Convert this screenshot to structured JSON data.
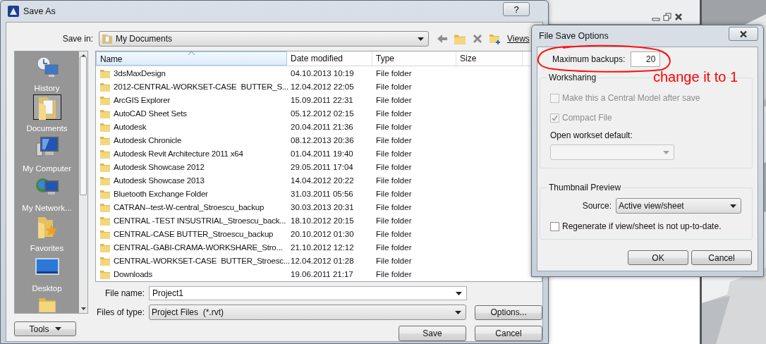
{
  "save_as": {
    "title": "Save As",
    "help": "?",
    "save_in": {
      "label": "Save in:",
      "value": "My Documents"
    },
    "views": "Views",
    "places": [
      {
        "label": "History",
        "kind": "history",
        "selected": false
      },
      {
        "label": "Documents",
        "kind": "documents",
        "selected": true
      },
      {
        "label": "My Computer",
        "kind": "computer",
        "selected": false
      },
      {
        "label": "My Network...",
        "kind": "network",
        "selected": false
      },
      {
        "label": "Favorites",
        "kind": "favorites",
        "selected": false
      },
      {
        "label": "Desktop",
        "kind": "desktop",
        "selected": false
      }
    ],
    "columns": [
      {
        "label": "Name",
        "sorted": true
      },
      {
        "label": "Date modified",
        "sorted": false
      },
      {
        "label": "Type",
        "sorted": false
      },
      {
        "label": "Size",
        "sorted": false
      }
    ],
    "rows": [
      {
        "name": "3dsMaxDesign",
        "date": "04.10.2013 10:19",
        "type": "File folder"
      },
      {
        "name": "2012-CENTRAL-WORKSET-CASE  BUTTER_S...",
        "date": "12.04.2012 22:05",
        "type": "File folder"
      },
      {
        "name": "ArcGIS Explorer",
        "date": "15.09.2011 22:31",
        "type": "File folder"
      },
      {
        "name": "AutoCAD Sheet Sets",
        "date": "05.12.2012 02:15",
        "type": "File folder"
      },
      {
        "name": "Autodesk",
        "date": "20.04.2011 21:36",
        "type": "File folder"
      },
      {
        "name": "Autodesk Chronicle",
        "date": "08.12.2013 20:36",
        "type": "File folder"
      },
      {
        "name": "Autodesk Revit Architecture 2011 x64",
        "date": "01.04.2011 19:40",
        "type": "File folder"
      },
      {
        "name": "Autodesk Showcase 2012",
        "date": "29.05.2011 17:04",
        "type": "File folder"
      },
      {
        "name": "Autodesk Showcase 2013",
        "date": "14.04.2012 20:22",
        "type": "File folder"
      },
      {
        "name": "Bluetooth Exchange Folder",
        "date": "31.03.2011 05:56",
        "type": "File folder"
      },
      {
        "name": "CATRAN--test-W-central_Stroescu_backup",
        "date": "30.03.2013 20:31",
        "type": "File folder"
      },
      {
        "name": "CENTRAL -TEST INSUSTRIAL_Stroescu_back...",
        "date": "18.10.2012 20:15",
        "type": "File folder"
      },
      {
        "name": "CENTRAL-CASE BUTTER_Stroescu_backup",
        "date": "20.10.2012 01:30",
        "type": "File folder"
      },
      {
        "name": "CENTRAL-GABI-CRAMA-WORKSHARE_Stro...",
        "date": "21.10.2012 12:12",
        "type": "File folder"
      },
      {
        "name": "CENTRAL-WORKSET-CASE  BUTTER_Stroesc...",
        "date": "12.04.2012 01:28",
        "type": "File folder"
      },
      {
        "name": "Downloads",
        "date": "19.06.2011 21:17",
        "type": "File folder"
      }
    ],
    "file_name": {
      "label": "File name:",
      "value": "Project1"
    },
    "file_type": {
      "label": "Files of type:",
      "value": "Project Files  (*.rvt)"
    },
    "buttons": {
      "tools": "Tools",
      "options": "Options...",
      "save": "Save",
      "cancel": "Cancel"
    }
  },
  "file_save_options": {
    "title": "File Save Options",
    "max_backups": {
      "label": "Maximum backups:",
      "value": "20"
    },
    "worksharing": {
      "title": "Worksharing",
      "checkboxes": [
        {
          "label": "Make this a Central Model after save",
          "checked": false,
          "disabled": true
        },
        {
          "label": "Compact File",
          "checked": true,
          "disabled": true
        }
      ],
      "workset": {
        "label": "Open workset default:",
        "disabled": true
      }
    },
    "thumbnail": {
      "title": "Thumbnail Preview",
      "source_label": "Source:",
      "source_value": "Active view/sheet",
      "regenerate": {
        "label": "Regenerate if view/sheet is not up-to-date.",
        "checked": false
      }
    },
    "buttons": [
      "OK",
      "Cancel"
    ]
  },
  "annotation": {
    "text": "change it to 1"
  }
}
